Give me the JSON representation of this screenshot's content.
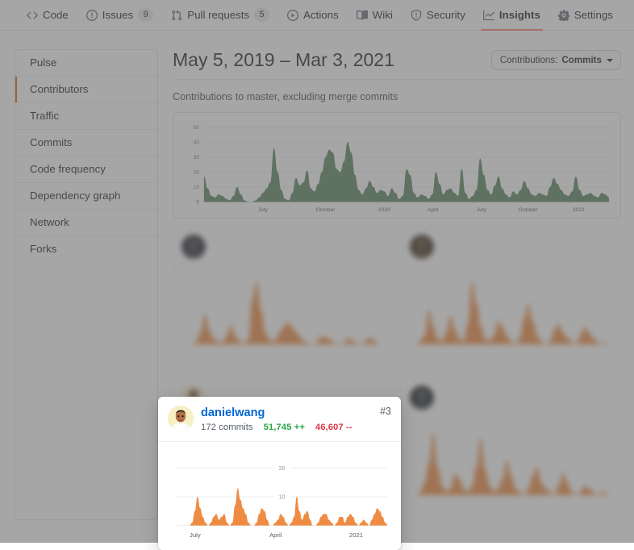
{
  "nav": {
    "tabs": [
      {
        "label": "Code",
        "icon": "code-icon",
        "count": null,
        "active": false
      },
      {
        "label": "Issues",
        "icon": "issue-opened-icon",
        "count": "9",
        "active": false
      },
      {
        "label": "Pull requests",
        "icon": "git-pull-request-icon",
        "count": "5",
        "active": false
      },
      {
        "label": "Actions",
        "icon": "play-icon",
        "count": null,
        "active": false
      },
      {
        "label": "Wiki",
        "icon": "book-icon",
        "count": null,
        "active": false
      },
      {
        "label": "Security",
        "icon": "shield-icon",
        "count": null,
        "active": false
      },
      {
        "label": "Insights",
        "icon": "graph-icon",
        "count": null,
        "active": true
      },
      {
        "label": "Settings",
        "icon": "gear-icon",
        "count": null,
        "active": false
      }
    ],
    "active_underline_color": "#f9826c"
  },
  "sidebar": {
    "items": [
      {
        "label": "Pulse",
        "selected": false
      },
      {
        "label": "Contributors",
        "selected": true
      },
      {
        "label": "Traffic",
        "selected": false
      },
      {
        "label": "Commits",
        "selected": false
      },
      {
        "label": "Code frequency",
        "selected": false
      },
      {
        "label": "Dependency graph",
        "selected": false
      },
      {
        "label": "Network",
        "selected": false
      },
      {
        "label": "Forks",
        "selected": false
      }
    ],
    "selected_marker_color": "#e36209"
  },
  "main": {
    "date_range": "May 5, 2019 – Mar 3, 2021",
    "contributions_button": {
      "prefix": "Contributions:",
      "value": "Commits"
    },
    "subtitle": "Contributions to master, excluding merge commits"
  },
  "chart_data": [
    {
      "id": "overall-commits-area",
      "type": "area",
      "title": "Contributions to master, excluding merge commits",
      "xlabel": "",
      "ylabel": "",
      "ylim": [
        0,
        50
      ],
      "yticks": [
        0,
        10,
        20,
        30,
        40,
        50
      ],
      "xticks": [
        "July",
        "October",
        "2020",
        "April",
        "July",
        "October",
        "2021"
      ],
      "xtick_positions": [
        0.145,
        0.3,
        0.445,
        0.565,
        0.685,
        0.8,
        0.925
      ],
      "grid": true,
      "color": "#5d8a63",
      "x_range": "May 5, 2019 – Mar 3, 2021",
      "values": [
        17,
        9,
        4,
        3,
        5,
        4,
        2,
        1,
        4,
        10,
        5,
        1,
        0,
        0,
        1,
        3,
        6,
        9,
        13,
        36,
        20,
        8,
        2,
        1,
        6,
        16,
        11,
        13,
        21,
        9,
        7,
        12,
        20,
        30,
        35,
        33,
        22,
        20,
        27,
        40,
        33,
        18,
        8,
        5,
        9,
        14,
        10,
        6,
        8,
        7,
        4,
        9,
        6,
        2,
        4,
        22,
        18,
        6,
        3,
        5,
        4,
        2,
        5,
        20,
        12,
        5,
        8,
        9,
        6,
        4,
        22,
        6,
        2,
        4,
        8,
        29,
        18,
        8,
        5,
        11,
        17,
        9,
        5,
        3,
        7,
        5,
        8,
        14,
        9,
        5,
        4,
        6,
        5,
        4,
        10,
        16,
        12,
        8,
        5,
        4,
        7,
        17,
        8,
        4,
        5,
        6,
        4,
        3,
        6,
        5,
        3
      ]
    },
    {
      "id": "danielwang-commits-sparkline",
      "type": "area",
      "title": "",
      "ylim": [
        0,
        24
      ],
      "yticks": [
        10,
        20
      ],
      "xticks": [
        "July",
        "April",
        "2021"
      ],
      "xtick_positions": [
        0.09,
        0.47,
        0.85
      ],
      "grid": true,
      "color": "#ef8c43",
      "values": [
        0,
        0,
        0,
        0,
        0,
        0,
        1,
        5,
        10,
        6,
        3,
        1,
        0,
        1,
        3,
        4,
        2,
        3,
        4,
        1,
        0,
        1,
        7,
        13,
        9,
        6,
        4,
        1,
        0,
        0,
        1,
        4,
        6,
        5,
        2,
        0,
        0,
        1,
        2,
        4,
        3,
        1,
        0,
        1,
        3,
        10,
        5,
        2,
        4,
        5,
        2,
        0,
        0,
        1,
        3,
        4,
        4,
        2,
        1,
        0,
        1,
        3,
        3,
        1,
        3,
        4,
        3,
        1,
        0,
        1,
        2,
        1,
        0,
        2,
        4,
        6,
        5,
        3,
        1,
        0
      ]
    }
  ],
  "focused_contributor": {
    "username": "danielwang",
    "rank": "#3",
    "commits": "172 commits",
    "additions": "51,745 ++",
    "deletions": "46,607 --",
    "additions_color": "#28a745",
    "deletions_color": "#d73a49"
  },
  "background_cards": [
    {
      "id": "card-1",
      "blurred": true
    },
    {
      "id": "card-2",
      "blurred": true
    },
    {
      "id": "card-3",
      "blurred": true
    },
    {
      "id": "card-4",
      "blurred": true
    }
  ]
}
